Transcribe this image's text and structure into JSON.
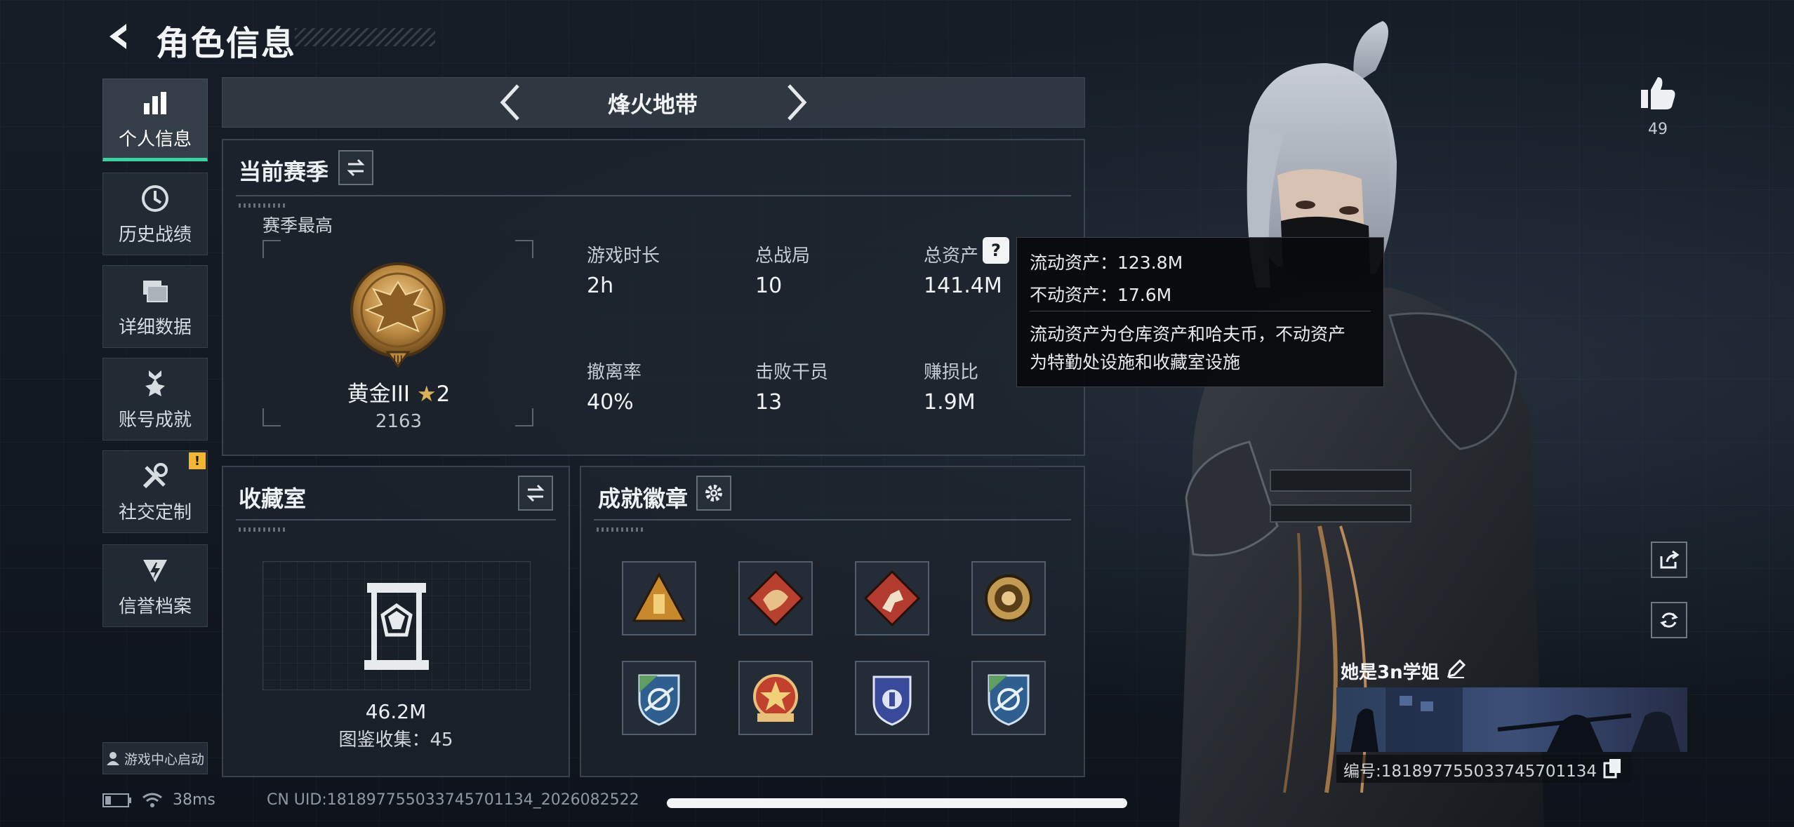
{
  "header": {
    "title": "角色信息"
  },
  "sidebar": {
    "items": [
      {
        "label": "个人信息",
        "icon": "bar-chart-icon",
        "active": true
      },
      {
        "label": "历史战绩",
        "icon": "clock-icon"
      },
      {
        "label": "详细数据",
        "icon": "folders-icon"
      },
      {
        "label": "账号成就",
        "icon": "medal-icon"
      },
      {
        "label": "社交定制",
        "icon": "tools-icon",
        "badge": "!"
      },
      {
        "label": "信誉档案",
        "icon": "shield-bolt-icon"
      }
    ],
    "game_center": "游戏中心启动"
  },
  "mode": {
    "label": "烽火地带"
  },
  "season": {
    "title": "当前赛季",
    "best_label": "赛季最高",
    "rank": "黄金III",
    "stars": "2",
    "score": "2163",
    "stats": [
      {
        "label": "游戏时长",
        "value": "2h"
      },
      {
        "label": "总战局",
        "value": "10"
      },
      {
        "label": "总资产",
        "value": "141.4M"
      },
      {
        "label": "撤离率",
        "value": "40%"
      },
      {
        "label": "击败干员",
        "value": "13"
      },
      {
        "label": "赚损比",
        "value": "1.9M"
      }
    ]
  },
  "tooltip": {
    "liquid": "流动资产：123.8M",
    "fixed": "不动资产：17.6M",
    "desc_line1": "流动资产为仓库资产和哈夫币，不动资产",
    "desc_line2": "为特勤处设施和收藏室设施"
  },
  "collection": {
    "title": "收藏室",
    "value": "46.2M",
    "count": "图鉴收集：45"
  },
  "achievements": {
    "title": "成就徽章",
    "badges": [
      {
        "icon": "pyramid-badge-icon",
        "color": "#c8892c"
      },
      {
        "icon": "dragon-badge-icon",
        "color": "#b8402e"
      },
      {
        "icon": "runner-badge-icon",
        "color": "#b23a2e"
      },
      {
        "icon": "emblem-badge-icon",
        "color": "#c29a52"
      },
      {
        "icon": "shield-rifle-badge-icon",
        "color": "#3f7fb8"
      },
      {
        "icon": "star-wreath-badge-icon",
        "color": "#c2402e"
      },
      {
        "icon": "police-shield-badge-icon",
        "color": "#5a6cc4"
      },
      {
        "icon": "shield-rifle-badge-icon",
        "color": "#3f7fb8"
      }
    ]
  },
  "profile": {
    "likes": "49",
    "name": "她是3n学姐",
    "id_text": "编号:1818977550337457011​34"
  },
  "status": {
    "ping": "38ms",
    "uid": "CN UID:1818977550337457011​34_2026082522"
  },
  "colors": {
    "accent": "#3ad29f",
    "warning": "#f2b630"
  }
}
